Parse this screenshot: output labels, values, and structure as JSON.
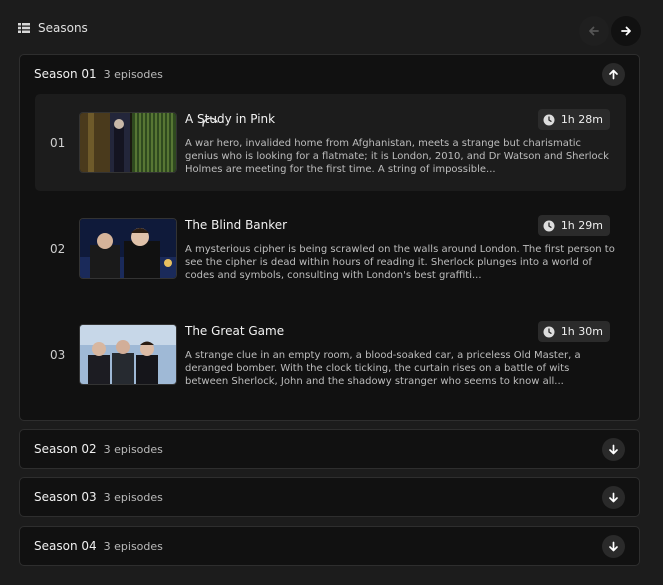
{
  "header": {
    "title": "Seasons",
    "grid_icon": "grid-list-icon",
    "prev_icon": "arrow-left-icon",
    "next_icon": "arrow-right-icon"
  },
  "seasons": [
    {
      "title": "Season 01",
      "count": "3 episodes",
      "expanded": true,
      "toggle_icon": "arrow-up-icon",
      "episodes": [
        {
          "number": "01",
          "title": "A Study in Pink",
          "duration": "1h 28m",
          "description": "A war hero, invalided home from Afghanistan, meets a strange but charismatic genius who is looking for a flatmate; it is London, 2010, and Dr Watson and Sherlock Holmes are meeting for the first time. A string of impossible..."
        },
        {
          "number": "02",
          "title": "The Blind Banker",
          "duration": "1h 29m",
          "description": "A mysterious cipher is being scrawled on the walls around London. The first person to see the cipher is dead within hours of reading it. Sherlock plunges into a world of codes and symbols, consulting with London's best graffiti..."
        },
        {
          "number": "03",
          "title": "The Great Game",
          "duration": "1h 30m",
          "description": "A strange clue in an empty room, a blood-soaked car, a priceless Old Master, a deranged bomber. With the clock ticking, the curtain rises on a battle of wits between Sherlock, John and the shadowy stranger who seems to know all..."
        }
      ]
    },
    {
      "title": "Season 02",
      "count": "3 episodes",
      "expanded": false,
      "toggle_icon": "arrow-down-icon"
    },
    {
      "title": "Season 03",
      "count": "3 episodes",
      "expanded": false,
      "toggle_icon": "arrow-down-icon"
    },
    {
      "title": "Season 04",
      "count": "3 episodes",
      "expanded": false,
      "toggle_icon": "arrow-down-icon"
    }
  ],
  "colors": {
    "background": "#1c1c1c",
    "panel": "#111111",
    "active_row": "#1c1c1c",
    "text": "#f0f0f0",
    "muted": "#bdbdbd"
  }
}
